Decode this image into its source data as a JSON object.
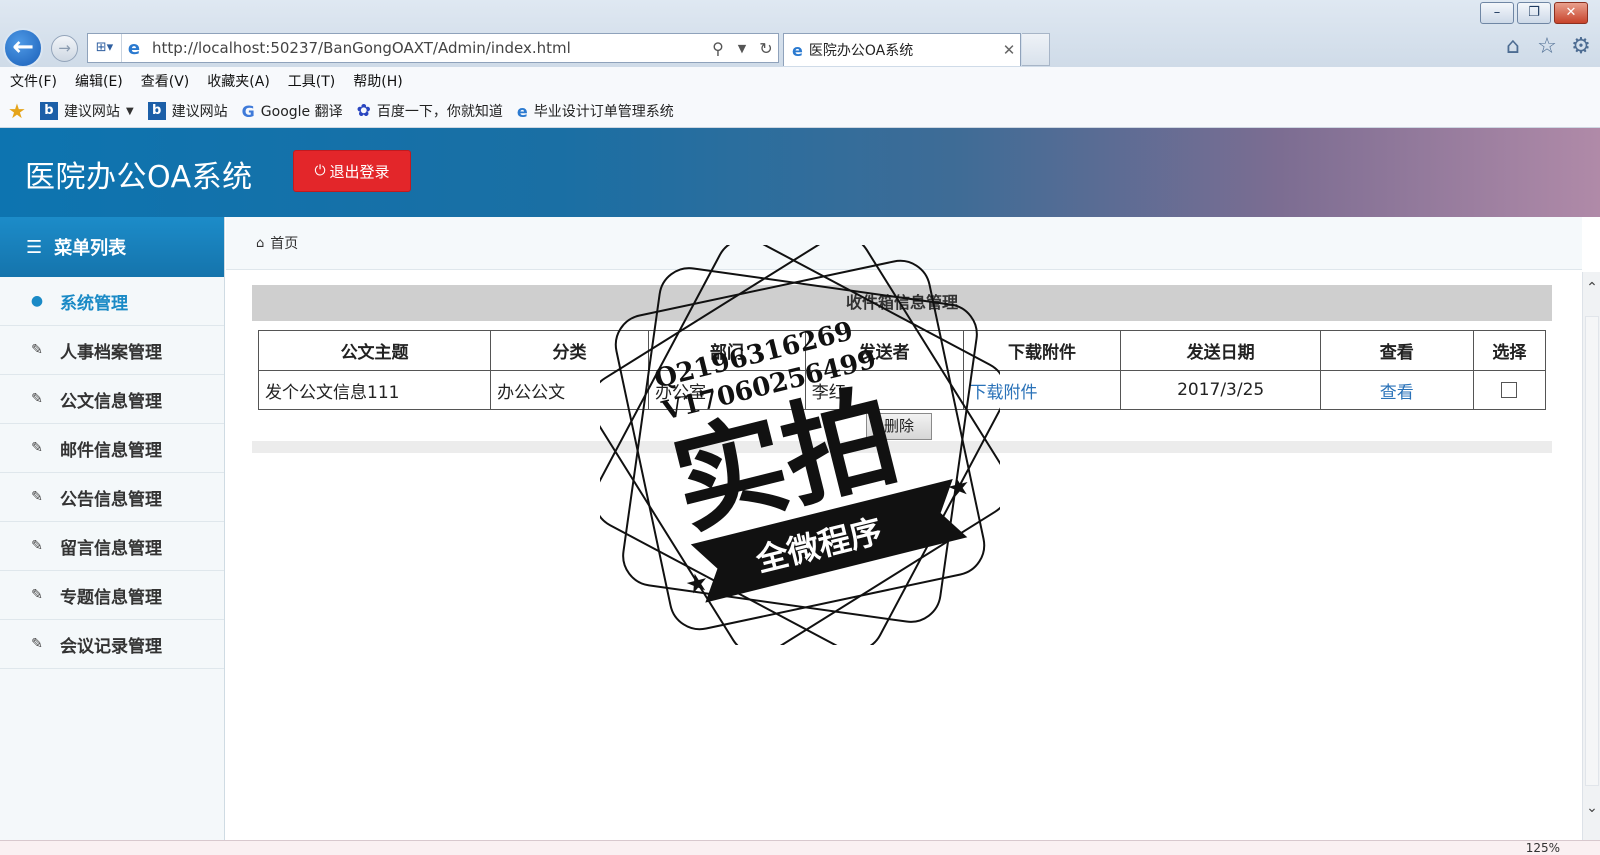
{
  "browser": {
    "url": "http://localhost:50237/BanGongOAXT/Admin/index.html",
    "tab_title": "医院办公OA系统",
    "menu": [
      "文件(F)",
      "编辑(E)",
      "查看(V)",
      "收藏夹(A)",
      "工具(T)",
      "帮助(H)"
    ],
    "favorites": [
      {
        "label": "建议网站",
        "icon": "bing-icon",
        "dropdown": true
      },
      {
        "label": "建议网站",
        "icon": "bing-icon"
      },
      {
        "label": "Google 翻译",
        "icon": "google-icon"
      },
      {
        "label": "百度一下，你就知道",
        "icon": "baidu-paw-icon"
      },
      {
        "label": "毕业设计订单管理系统",
        "icon": "ie-icon"
      }
    ],
    "zoom": "125%"
  },
  "app": {
    "title": "医院办公OA系统",
    "logout_label": "退出登录"
  },
  "sidebar": {
    "header": "菜单列表",
    "items": [
      {
        "label": "系统管理",
        "icon": "user-icon",
        "active": true
      },
      {
        "label": "人事档案管理",
        "icon": "edit-icon"
      },
      {
        "label": "公文信息管理",
        "icon": "edit-icon"
      },
      {
        "label": "邮件信息管理",
        "icon": "edit-icon"
      },
      {
        "label": "公告信息管理",
        "icon": "edit-icon"
      },
      {
        "label": "留言信息管理",
        "icon": "edit-icon"
      },
      {
        "label": "专题信息管理",
        "icon": "edit-icon"
      },
      {
        "label": "会议记录管理",
        "icon": "edit-icon"
      }
    ]
  },
  "main": {
    "breadcrumb": "首页",
    "section_title": "收件箱信息管理",
    "table": {
      "headers": [
        "公文主题",
        "分类",
        "部门",
        "发送者",
        "下载附件",
        "发送日期",
        "查看",
        "选择"
      ],
      "rows": [
        {
          "subject": "发个公文信息111",
          "category": "办公公文",
          "department": "办公室",
          "sender": "李红",
          "attachment": "下载附件",
          "date": "2017/3/25",
          "view": "查看"
        }
      ]
    },
    "delete_label": "删除"
  },
  "watermark": {
    "line1": "Q2196316269",
    "line2": "V17060256499",
    "big_text": "实拍",
    "ribbon": "全微程序"
  },
  "colors": {
    "header_blue": "#1574ac",
    "logout_red": "#e3262a",
    "link_blue": "#2a72b8",
    "active_item": "#1a8ac6"
  }
}
